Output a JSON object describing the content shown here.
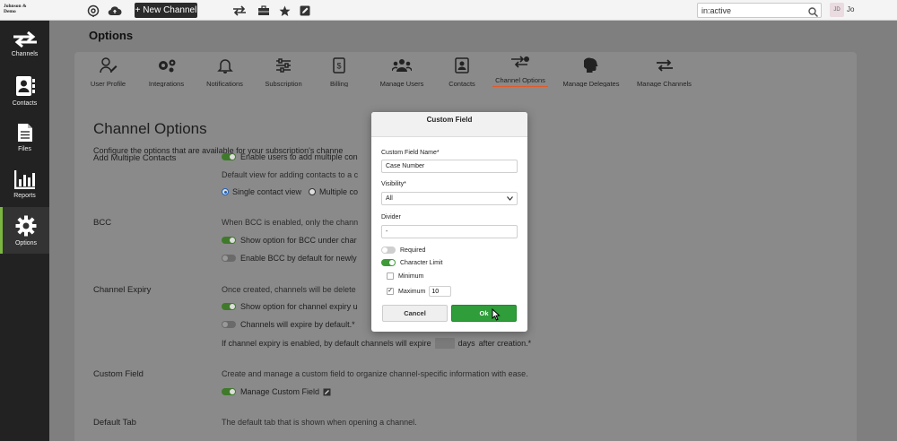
{
  "topbar": {
    "brand": "Johnson & Demo",
    "new_channel_label": "+ New Channel",
    "search_value": "in:active",
    "avatar_initials": "JD",
    "user_name": "Jo"
  },
  "sidebar": {
    "items": [
      {
        "label": "Channels",
        "icon": "arrows-icon"
      },
      {
        "label": "Contacts",
        "icon": "contact-card-icon"
      },
      {
        "label": "Files",
        "icon": "file-icon"
      },
      {
        "label": "Reports",
        "icon": "bar-chart-icon"
      },
      {
        "label": "Options",
        "icon": "gear-icon",
        "active": true
      }
    ]
  },
  "main": {
    "title": "Options",
    "tabs": [
      {
        "label": "User Profile"
      },
      {
        "label": "Integrations"
      },
      {
        "label": "Notifications"
      },
      {
        "label": "Subscription"
      },
      {
        "label": "Billing"
      },
      {
        "label": "Manage Users"
      },
      {
        "label": "Contacts"
      },
      {
        "label": "Channel Options",
        "active": true
      },
      {
        "label": "Manage Delegates"
      },
      {
        "label": "Manage Channels"
      }
    ],
    "heading": "Channel Options",
    "description": "Configure the options that are available for your subscription's channe",
    "sections": {
      "add_multiple": {
        "label": "Add Multiple Contacts",
        "toggle_text": "Enable users to add multiple con",
        "default_view_text": "Default view for adding contacts to a c",
        "radio_single": "Single contact view",
        "radio_multiple": "Multiple co"
      },
      "bcc": {
        "label": "BCC",
        "desc": "When BCC is enabled, only the chann",
        "opt1": "Show option for BCC under char",
        "opt2": "Enable BCC by default for newly"
      },
      "expiry": {
        "label": "Channel Expiry",
        "desc": "Once created, channels will be delete",
        "opt1": "Show option for channel expiry u",
        "opt2": "Channels will expire by default.*",
        "line_before": "If channel expiry is enabled, by default channels will expire",
        "line_days": "days",
        "line_after": "after creation.*"
      },
      "custom_field": {
        "label": "Custom Field",
        "desc": "Create and manage a custom field to organize channel-specific information with ease.",
        "opt1": "Manage Custom Field"
      },
      "default_tab": {
        "label": "Default Tab",
        "desc": "The default tab that is shown when opening a channel."
      }
    }
  },
  "modal": {
    "title": "Custom Field",
    "name_label": "Custom Field Name*",
    "name_value": "Case Number",
    "visibility_label": "Visibility*",
    "visibility_value": "All",
    "divider_label": "Divider",
    "divider_value": "-",
    "required_label": "Required",
    "char_limit_label": "Character Limit",
    "minimum_label": "Minimum",
    "maximum_label": "Maximum",
    "maximum_value": "10",
    "cancel_label": "Cancel",
    "ok_label": "Ok"
  },
  "colors": {
    "accent_green": "#2e9d3a",
    "active_tab_underline": "#e05a2a",
    "sidebar_bg": "#222222"
  }
}
